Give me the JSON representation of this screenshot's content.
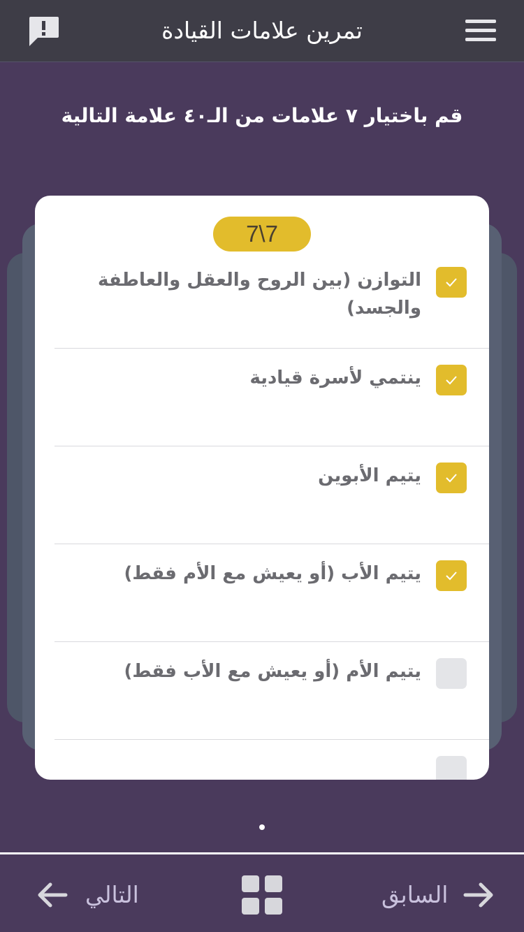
{
  "header": {
    "title": "تمرين علامات القيادة",
    "menu_icon": "hamburger-menu-icon",
    "report_icon": "report-speech-bubble-icon"
  },
  "instruction": "قم باختيار ٧ علامات من الـ٤٠ علامة التالية",
  "card": {
    "counter": "7\\7",
    "options": [
      {
        "label": "التوازن (بين الروح والعقل والعاطفة والجسد)",
        "checked": true
      },
      {
        "label": "ينتمي لأسرة قيادية",
        "checked": true
      },
      {
        "label": "يتيم الأبوين",
        "checked": true
      },
      {
        "label": "يتيم الأب (أو يعيش مع الأم فقط)",
        "checked": true
      },
      {
        "label": "يتيم الأم (أو يعيش مع الأب فقط)",
        "checked": false
      }
    ]
  },
  "pagination": {
    "current": 1,
    "total": 1
  },
  "footer": {
    "next_label": "التالي",
    "prev_label": "السابق",
    "grid_icon": "grid-menu-icon"
  },
  "colors": {
    "background": "#4a3a5c",
    "header": "#3e3d47",
    "accent": "#e2bc2c",
    "nav_text": "#c9c1dd"
  }
}
